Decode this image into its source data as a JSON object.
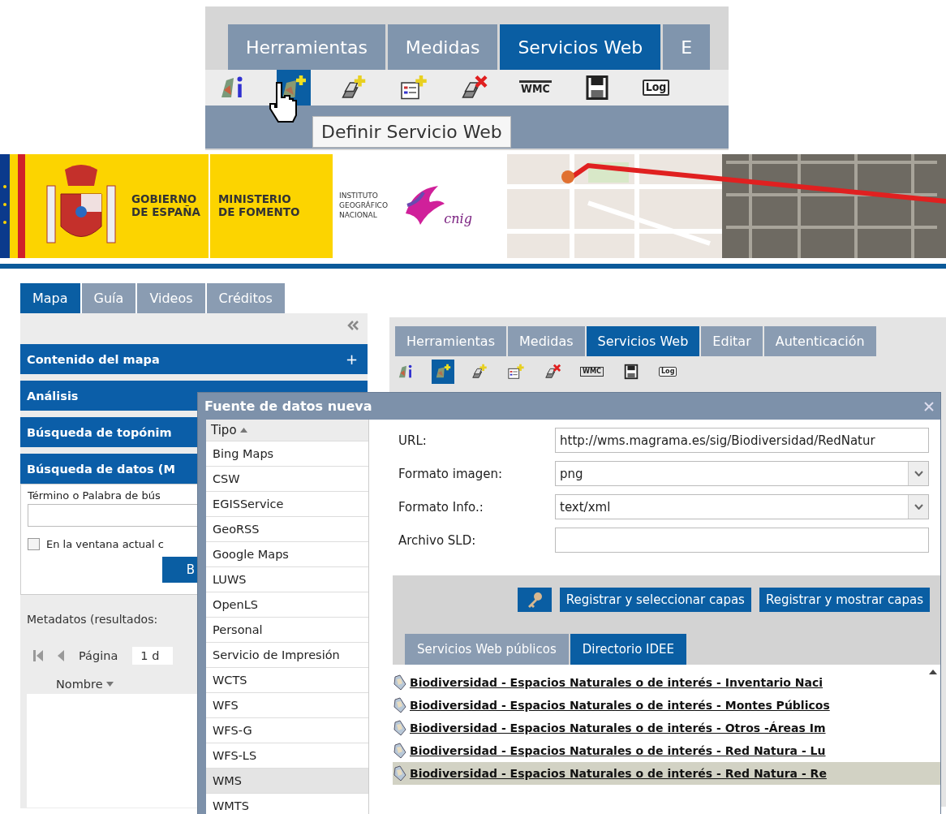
{
  "inset": {
    "tabs": [
      {
        "label": "Herramientas",
        "selected": false
      },
      {
        "label": "Medidas",
        "selected": false
      },
      {
        "label": "Servicios Web",
        "selected": true
      },
      {
        "label": "E",
        "selected": false
      }
    ],
    "tools": [
      {
        "kind": "info",
        "selected": false
      },
      {
        "kind": "define",
        "selected": true
      },
      {
        "kind": "add-layer",
        "selected": false
      },
      {
        "kind": "add-form",
        "selected": false
      },
      {
        "kind": "remove",
        "selected": false
      },
      {
        "kind": "wmc",
        "label": "WMC",
        "selected": false
      },
      {
        "kind": "save",
        "selected": false
      },
      {
        "kind": "log",
        "label": "Log",
        "selected": false
      }
    ],
    "tooltip": "Definir Servicio Web"
  },
  "banner": {
    "gobierno": [
      "GOBIERNO",
      "DE ESPAÑA"
    ],
    "ministerio": [
      "MINISTERIO",
      "DE FOMENTO"
    ],
    "instituto": [
      "INSTITUTO",
      "GEOGRÁFICO",
      "NACIONAL"
    ],
    "logo_text": "cnig"
  },
  "left_panel": {
    "tabs": [
      {
        "label": "Mapa",
        "selected": true
      },
      {
        "label": "Guía",
        "selected": false
      },
      {
        "label": "Videos",
        "selected": false
      },
      {
        "label": "Créditos",
        "selected": false
      }
    ],
    "sections": [
      {
        "title": "Contenido del mapa",
        "toggle": "+"
      },
      {
        "title": "Análisis"
      },
      {
        "title": "Búsqueda de topónim"
      },
      {
        "title": "Búsqueda de datos (M"
      }
    ],
    "search": {
      "label": "Término o Palabra de bús",
      "checkbox": {
        "label": "En la ventana actual c",
        "checked": false
      },
      "button": "B"
    },
    "results_label": "Metadatos (resultados:",
    "pager": {
      "label": "Página",
      "value": "1 d"
    },
    "column": "Nombre"
  },
  "map_tabs": [
    {
      "label": "Herramientas",
      "selected": false
    },
    {
      "label": "Medidas",
      "selected": false
    },
    {
      "label": "Servicios Web",
      "selected": true
    },
    {
      "label": "Editar",
      "selected": false
    },
    {
      "label": "Autenticación",
      "selected": false
    }
  ],
  "map_tools": [
    {
      "kind": "info",
      "selected": false
    },
    {
      "kind": "define",
      "selected": true
    },
    {
      "kind": "add-layer",
      "selected": false
    },
    {
      "kind": "add-form",
      "selected": false
    },
    {
      "kind": "remove",
      "selected": false
    },
    {
      "kind": "wmc",
      "label": "WMC",
      "selected": false
    },
    {
      "kind": "save",
      "selected": false
    },
    {
      "kind": "log",
      "label": "Log",
      "selected": false
    }
  ],
  "dialog": {
    "title": "Fuente de datos nueva",
    "type_column": "Tipo",
    "types": [
      {
        "label": "Bing Maps",
        "selected": false
      },
      {
        "label": "CSW",
        "selected": false
      },
      {
        "label": "EGISService",
        "selected": false
      },
      {
        "label": "GeoRSS",
        "selected": false
      },
      {
        "label": "Google Maps",
        "selected": false
      },
      {
        "label": "LUWS",
        "selected": false
      },
      {
        "label": "OpenLS",
        "selected": false
      },
      {
        "label": "Personal",
        "selected": false
      },
      {
        "label": "Servicio de Impresión",
        "selected": false
      },
      {
        "label": "WCTS",
        "selected": false
      },
      {
        "label": "WFS",
        "selected": false
      },
      {
        "label": "WFS-G",
        "selected": false
      },
      {
        "label": "WFS-LS",
        "selected": false
      },
      {
        "label": "WMS",
        "selected": true
      },
      {
        "label": "WMTS",
        "selected": false
      }
    ],
    "fields": [
      {
        "label": "URL:",
        "kind": "text",
        "value": "http://wms.magrama.es/sig/Biodiversidad/RedNatur"
      },
      {
        "label": "Formato imagen:",
        "kind": "select",
        "value": "png"
      },
      {
        "label": "Formato Info.:",
        "kind": "select",
        "value": "text/xml"
      },
      {
        "label": "Archivo SLD:",
        "kind": "text"
      }
    ],
    "buttons": [
      "Registrar y seleccionar capas",
      "Registrar y mostrar capas"
    ],
    "tabs": [
      {
        "label": "Servicios Web públicos",
        "selected": false
      },
      {
        "label": "Directorio IDEE",
        "selected": true
      }
    ],
    "services": [
      {
        "label": "Biodiversidad - Espacios Naturales o de interés - Inventario Naci",
        "selected": false
      },
      {
        "label": "Biodiversidad - Espacios Naturales o de interés - Montes Públicos",
        "selected": false
      },
      {
        "label": "Biodiversidad - Espacios Naturales o de interés - Otros -Áreas Im",
        "selected": false
      },
      {
        "label": "Biodiversidad - Espacios Naturales o de interés - Red Natura - Lu",
        "selected": false
      },
      {
        "label": "Biodiversidad - Espacios Naturales o de interés - Red Natura - Re",
        "selected": true
      }
    ]
  }
}
